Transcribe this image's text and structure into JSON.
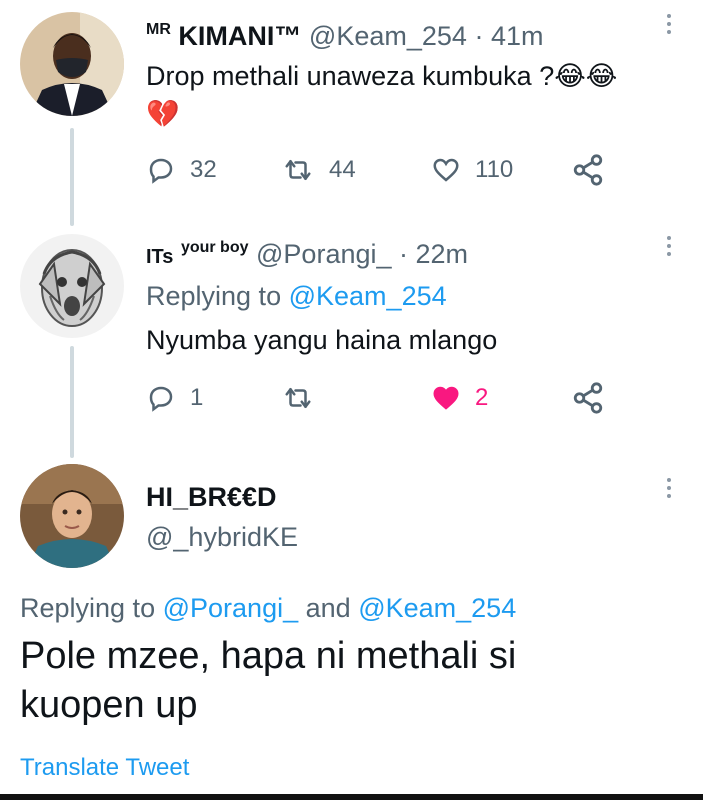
{
  "tweets": [
    {
      "name_prefix": "MR",
      "name": "KIMANI™",
      "handle": "@Keam_254",
      "time": "· 41m",
      "text": "Drop methali unaweza kumbuka ?😂😂",
      "emoji_line": "💔",
      "actions": {
        "replies": "32",
        "retweets": "44",
        "likes": "110"
      }
    },
    {
      "name_prefix": "ITs",
      "name": "your boy",
      "handle": "@Porangi_",
      "time": "· 22m",
      "replying_prefix": "Replying to",
      "replying_to": "@Keam_254",
      "text": "Nyumba yangu haina mlango",
      "actions": {
        "replies": "1",
        "retweets": "",
        "likes": "2"
      },
      "liked": true
    },
    {
      "name": "HI_BR€€D",
      "handle": "@_hybridKE",
      "replying_prefix": "Replying to",
      "replying_to_1": "@Porangi_",
      "replying_and": "and",
      "replying_to_2": "@Keam_254",
      "text_line1": "Pole mzee, hapa ni methali si",
      "text_line2": "kuopen up",
      "translate": "Translate Tweet"
    }
  ],
  "colors": {
    "link": "#1d9bf0",
    "muted": "#536471",
    "like": "#f91880",
    "thread": "#cfd9de"
  },
  "icons": [
    "reply-icon",
    "retweet-icon",
    "like-icon",
    "share-icon",
    "more-icon"
  ]
}
